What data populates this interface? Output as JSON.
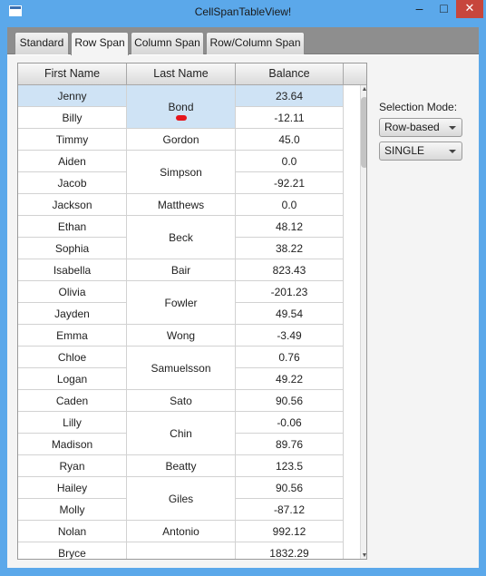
{
  "window": {
    "title": "CellSpanTableView!",
    "minimize": "–",
    "maximize": "□",
    "close": "✕"
  },
  "tabs": [
    {
      "label": "Standard",
      "active": false
    },
    {
      "label": "Row Span",
      "active": true
    },
    {
      "label": "Column Span",
      "active": false
    },
    {
      "label": "Row/Column Span",
      "active": false
    }
  ],
  "table": {
    "columns": [
      "First Name",
      "Last Name",
      "Balance"
    ],
    "first_names": [
      "Jenny",
      "Billy",
      "Timmy",
      "Aiden",
      "Jacob",
      "Jackson",
      "Ethan",
      "Sophia",
      "Isabella",
      "Olivia",
      "Jayden",
      "Emma",
      "Chloe",
      "Logan",
      "Caden",
      "Lilly",
      "Madison",
      "Ryan",
      "Hailey",
      "Molly",
      "Nolan",
      "Bryce"
    ],
    "balances": [
      "23.64",
      "-12.11",
      "45.0",
      "0.0",
      "-92.21",
      "0.0",
      "48.12",
      "38.22",
      "823.43",
      "-201.23",
      "49.54",
      "-3.49",
      "0.76",
      "49.22",
      "90.56",
      "-0.06",
      "89.76",
      "123.5",
      "90.56",
      "-87.12",
      "992.12",
      "1832.29"
    ],
    "last_name_spans": [
      {
        "text": "Bond",
        "start": 0,
        "span": 2
      },
      {
        "text": "Gordon",
        "start": 2,
        "span": 1
      },
      {
        "text": "Simpson",
        "start": 3,
        "span": 2
      },
      {
        "text": "Matthews",
        "start": 5,
        "span": 1
      },
      {
        "text": "Beck",
        "start": 6,
        "span": 2
      },
      {
        "text": "Bair",
        "start": 8,
        "span": 1
      },
      {
        "text": "Fowler",
        "start": 9,
        "span": 2
      },
      {
        "text": "Wong",
        "start": 11,
        "span": 1
      },
      {
        "text": "Samuelsson",
        "start": 12,
        "span": 2
      },
      {
        "text": "Sato",
        "start": 14,
        "span": 1
      },
      {
        "text": "Chin",
        "start": 15,
        "span": 2
      },
      {
        "text": "Beatty",
        "start": 17,
        "span": 1
      },
      {
        "text": "Giles",
        "start": 18,
        "span": 2
      },
      {
        "text": "Antonio",
        "start": 20,
        "span": 1
      },
      {
        "text": "",
        "start": 21,
        "span": 1
      }
    ],
    "selected_row": 0
  },
  "selection": {
    "label": "Selection Mode:",
    "mode_value": "Row-based",
    "type_value": "SINGLE"
  },
  "colors": {
    "selection": "#cfe3f5",
    "window_frame": "#5ba8ea",
    "close_button": "#c7463c",
    "annotation_mark": "#e6161d"
  }
}
